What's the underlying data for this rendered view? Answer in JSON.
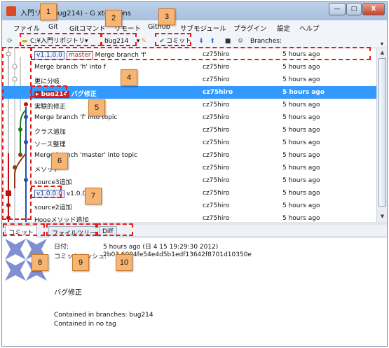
{
  "window": {
    "title": "入門リポ (bug214) - G xtensions",
    "buttons": {
      "minimize": "—",
      "maximize": "□",
      "close": "X"
    }
  },
  "menu": [
    "ファイル",
    "Git",
    "Gitコマンド",
    "リモート",
    "Github",
    "サブモジュール",
    "プラグイン",
    "設定",
    "ヘルプ"
  ],
  "toolbar": {
    "repo": "C:¥入門リポジトリ▾",
    "branch": "bug214",
    "commit_label": "コミット",
    "branches_label": "Branches:"
  },
  "commits": [
    {
      "tag": "v1.1.0.0",
      "branch": "master",
      "message": "Merge branch 'f'",
      "author": "cz75hiro",
      "date": "5 hours ago"
    },
    {
      "message": "Merge branch 'h' into f",
      "author": "cz75hiro",
      "date": "5 hours ago"
    },
    {
      "message": "更に分岐",
      "author": "cz75hiro",
      "date": "5 hours ago"
    },
    {
      "branch": "bug214",
      "message": "バグ修正",
      "author": "cz75hiro",
      "date": "5 hours ago",
      "selected": true
    },
    {
      "message": "実験的修正",
      "author": "cz75hiro",
      "date": "5 hours ago"
    },
    {
      "message": "Merge branch 'f' into topic",
      "author": "cz75hiro",
      "date": "5 hours ago"
    },
    {
      "message": "クラス追加",
      "author": "cz75hiro",
      "date": "5 hours ago"
    },
    {
      "message": "ソース整理",
      "author": "cz75hiro",
      "date": "5 hours ago"
    },
    {
      "message": "Merge branch 'master' into topic",
      "author": "cz75hiro",
      "date": "5 hours ago"
    },
    {
      "message": "メソッド",
      "author": "cz75hiro",
      "date": "5 hours ago"
    },
    {
      "message": "source3追加",
      "author": "cz75hiro",
      "date": "5 hours ago"
    },
    {
      "tag": "v1.0.0.0",
      "message": "v1.0.0.0",
      "author": "cz75hiro",
      "date": "5 hours ago"
    },
    {
      "message": "source2追加",
      "author": "cz75hiro",
      "date": "5 hours ago"
    },
    {
      "message": "Hogeメソッド追加",
      "author": "cz75hiro",
      "date": "5 hours ago"
    }
  ],
  "tabs": [
    "コミット",
    "ファイルツリー",
    "Diff"
  ],
  "detail": {
    "date_label": "日付:",
    "date_value": "5 hours ago (日 4 15 19:29:30 2012)",
    "hash_label": "コミットハッシュ:",
    "hash_value": "2b03 6094fe54e4d5b1edf13642f8701d10350e",
    "message": "バグ修正",
    "contained_branches": "Contained in branches: bug214",
    "contained_tag": "Contained in no tag"
  },
  "callouts": [
    "1",
    "2",
    "3",
    "4",
    "5",
    "6",
    "7",
    "8",
    "9",
    "10"
  ],
  "colors": {
    "accent_dash": "#e21b1b",
    "selection": "#3399ff",
    "callout": "#f7b574"
  }
}
